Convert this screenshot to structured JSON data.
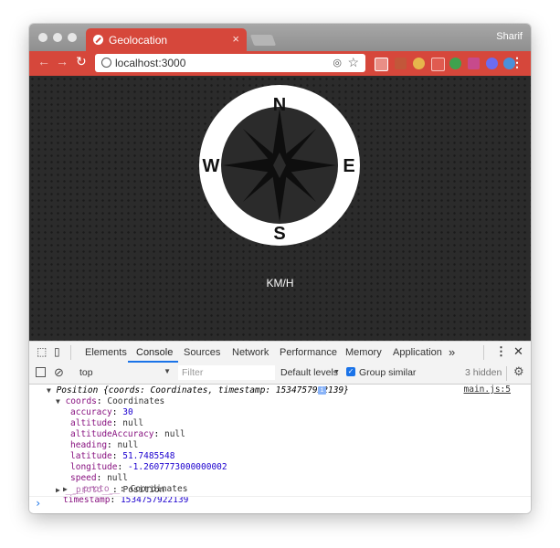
{
  "browser": {
    "tab_title": "Geolocation",
    "tab_close": "×",
    "user_name": "Sharif",
    "url": "localhost:3000"
  },
  "page": {
    "compass": {
      "north": "N",
      "south": "S",
      "east": "E",
      "west": "W"
    },
    "speed_unit": "KM/H"
  },
  "devtools": {
    "tabs": [
      "Elements",
      "Console",
      "Sources",
      "Network",
      "Performance",
      "Memory",
      "Application"
    ],
    "active_tab": "Console",
    "more_tabs": "»",
    "context_select": "top",
    "filter_placeholder": "Filter",
    "levels_label": "Default levels",
    "group_similar_label": "Group similar",
    "hidden_count": "3 hidden",
    "source_link": "main.js:5",
    "log": {
      "header_obj": "Position",
      "header_rest": "{coords: Coordinates, timestamp: 1534757922139}",
      "coords_key": "coords",
      "coords_type": "Coordinates",
      "props": [
        {
          "key": "accuracy",
          "value": "30",
          "num": true
        },
        {
          "key": "altitude",
          "value": "null",
          "num": false
        },
        {
          "key": "altitudeAccuracy",
          "value": "null",
          "num": false
        },
        {
          "key": "heading",
          "value": "null",
          "num": false
        },
        {
          "key": "latitude",
          "value": "51.7485548",
          "num": true
        },
        {
          "key": "longitude",
          "value": "-1.2607773000000002",
          "num": true
        },
        {
          "key": "speed",
          "value": "null",
          "num": false
        }
      ],
      "coords_proto_key": "__proto__",
      "coords_proto_val": "Coordinates",
      "timestamp_key": "timestamp",
      "timestamp_val": "1534757922139",
      "proto_key": "__proto__",
      "proto_val": "Position"
    },
    "prompt": "›"
  },
  "colors": {
    "accent": "#d6473b",
    "page_bg": "#2b2b2b",
    "devtools_blue": "#1a73e8"
  }
}
